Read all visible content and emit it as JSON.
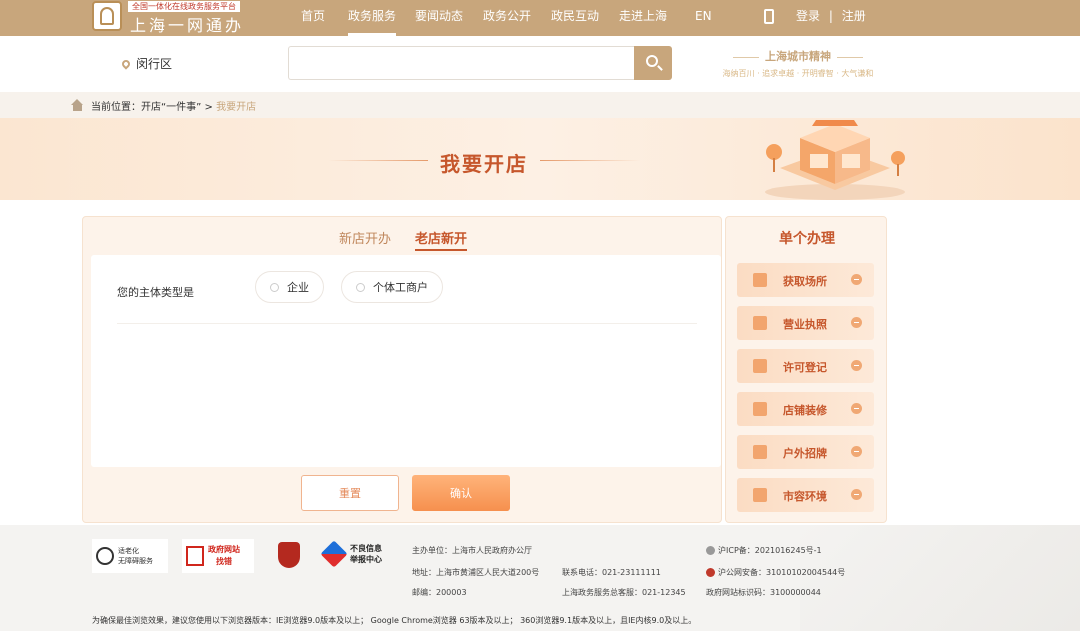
{
  "topnav": {
    "logo_tag": "全国一体化在线政务服务平台",
    "logo_name": "上海一网通办",
    "items": [
      {
        "label": "首页"
      },
      {
        "label": "政务服务"
      },
      {
        "label": "要闻动态"
      },
      {
        "label": "政务公开"
      },
      {
        "label": "政民互动"
      },
      {
        "label": "走进上海"
      },
      {
        "label": "EN"
      }
    ],
    "active_index": 1,
    "login_label": "登录",
    "separator": "|",
    "register_label": "注册"
  },
  "searchrow": {
    "location": "闵行区",
    "search_placeholder": "",
    "city_spirit_title": "上海城市精神",
    "city_spirit_sub": "海纳百川 · 追求卓越 · 开明睿智 · 大气谦和"
  },
  "breadcrumb": {
    "prefix": "当前位置：",
    "parent": "开店“一件事”",
    "separator": " > ",
    "current": "我要开店"
  },
  "banner": {
    "title": "我要开店"
  },
  "main": {
    "tabs": [
      {
        "label": "新店开办"
      },
      {
        "label": "老店新开"
      }
    ],
    "active_tab": 1,
    "form": {
      "question": "您的主体类型是",
      "options": [
        {
          "label": "企业"
        },
        {
          "label": "个体工商户"
        }
      ]
    },
    "buttons": {
      "reset": "重置",
      "confirm": "确认"
    }
  },
  "side": {
    "title": "单个办理",
    "items": [
      {
        "label": "获取场所",
        "icon": "person-icon"
      },
      {
        "label": "营业执照",
        "icon": "license-icon"
      },
      {
        "label": "许可登记",
        "icon": "permit-icon"
      },
      {
        "label": "店铺装修",
        "icon": "paint-roller-icon"
      },
      {
        "label": "户外招牌",
        "icon": "signboard-icon"
      },
      {
        "label": "市容环境",
        "icon": "environment-icon"
      }
    ]
  },
  "footer": {
    "badge_aged_line1": "适老化",
    "badge_aged_line2": "无障碍服务",
    "badge_gov_line1": "政府网站",
    "badge_gov_line2": "找错",
    "report_line1": "不良信息",
    "report_line2": "举报中心",
    "host": "主办单位：上海市人民政府办公厅",
    "address": "地址：上海市黄浦区人民大道200号",
    "phone": "联系电话：021-23111111",
    "postcode": "邮编：200003",
    "hotline": "上海政务服务总客服：021-12345",
    "icp": "沪ICP备：2021016245号-1",
    "police": "沪公网安备：31010102004544号",
    "site_id": "政府网站标识码：3100000044",
    "browser_note": "为确保最佳浏览效果，建议您使用以下浏览器版本：IE浏览器9.0版本及以上； Google Chrome浏览器 63版本及以上； 360浏览器9.1版本及以上，且IE内核9.0及以上。"
  },
  "colors": {
    "nav_bg": "#c8a67c",
    "accent": "#c6572c",
    "button_orange": "#f6904e"
  }
}
